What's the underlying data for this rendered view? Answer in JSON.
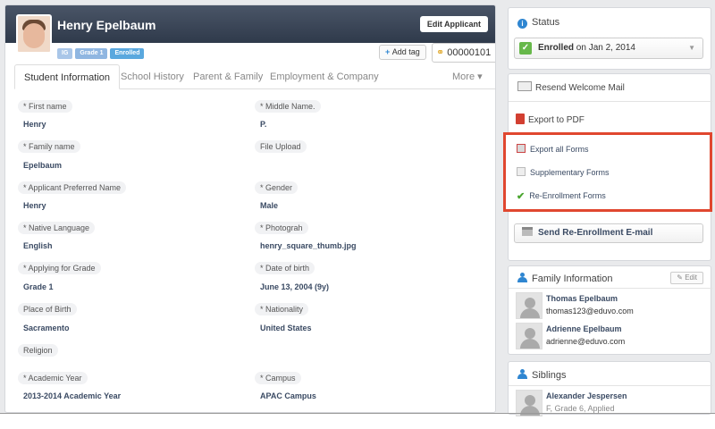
{
  "header": {
    "name": "Henry Epelbaum",
    "edit_button": "Edit Applicant",
    "badges": [
      "IG",
      "Grade 1",
      "Enrolled"
    ],
    "add_tag": "Add tag",
    "applicant_id": "00000101"
  },
  "tabs": [
    "Student Information",
    "School History",
    "Parent & Family",
    "Employment & Company",
    "More"
  ],
  "fields_left": [
    {
      "label": "* First name",
      "value": "Henry"
    },
    {
      "label": "* Family name",
      "value": "Epelbaum"
    },
    {
      "label": "* Applicant Preferred Name",
      "value": "Henry"
    },
    {
      "label": "* Native Language",
      "value": "English"
    },
    {
      "label": "* Applying for Grade",
      "value": "Grade 1"
    },
    {
      "label": "Place of Birth",
      "value": "Sacramento"
    },
    {
      "label": "Religion",
      "value": ""
    },
    {
      "label": "* Academic Year",
      "value": "2013-2014 Academic Year"
    }
  ],
  "fields_right": [
    {
      "label": "* Middle Name.",
      "value": "P."
    },
    {
      "label": "File Upload",
      "value": ""
    },
    {
      "label": "* Gender",
      "value": "Male"
    },
    {
      "label": "* Photograh",
      "value": "henry_square_thumb.jpg"
    },
    {
      "label": "* Date of birth",
      "value": "June 13, 2004 (9y)"
    },
    {
      "label": "* Nationality",
      "value": "United States"
    },
    {
      "label": "* Campus",
      "value": "APAC Campus"
    }
  ],
  "status": {
    "title": "Status",
    "selected_bold": "Enrolled",
    "selected_rest": " on Jan 2, 2014"
  },
  "actions": {
    "resend": "Resend Welcome Mail",
    "export_pdf": "Export to PDF",
    "menu": [
      "Export all Forms",
      "Supplementary Forms",
      "Re-Enrollment Forms"
    ],
    "reenroll_email": "Send Re-Enrollment E-mail"
  },
  "family": {
    "title": "Family Information",
    "edit": "Edit",
    "members": [
      {
        "name": "Thomas Epelbaum",
        "email": "thomas123@eduvo.com"
      },
      {
        "name": "Adrienne Epelbaum",
        "email": "adrienne@eduvo.com"
      }
    ]
  },
  "siblings": {
    "title": "Siblings",
    "members": [
      {
        "name": "Alexander Jespersen",
        "sub": "F, Grade 6, Applied"
      }
    ]
  }
}
